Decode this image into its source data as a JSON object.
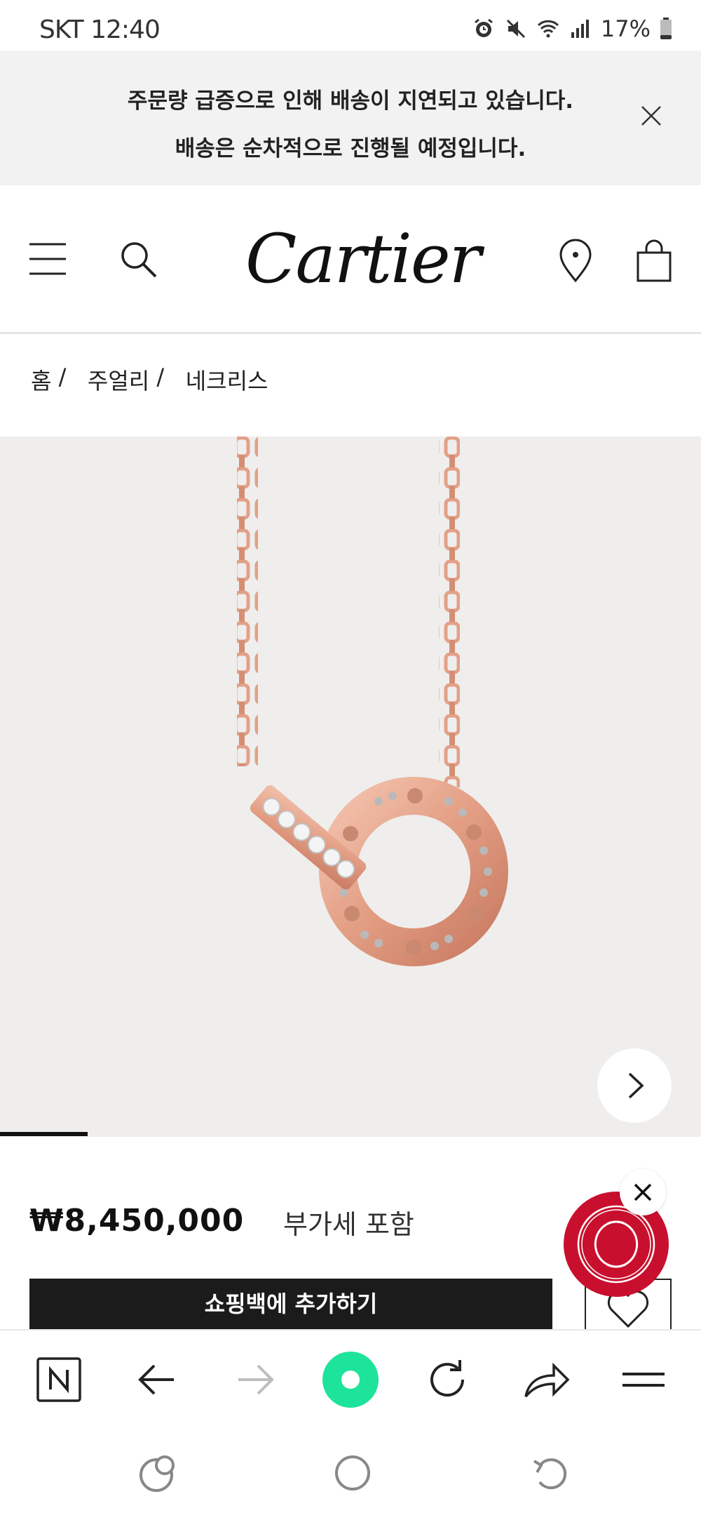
{
  "status_bar": {
    "carrier_time": "SKT 12:40",
    "battery": "17%",
    "icons": [
      "alarm-icon",
      "mute-icon",
      "wifi-icon",
      "signal-icon",
      "battery-icon"
    ]
  },
  "notice": {
    "line1": "주문량 급증으로 인해 배송이 지연되고 있습니다.",
    "line2": "배송은 순차적으로 진행될 예정입니다."
  },
  "header": {
    "logo": "Cartier",
    "icons": [
      "menu-icon",
      "search-icon",
      "location-icon",
      "shopping-bag-icon"
    ]
  },
  "breadcrumb": {
    "items": [
      "홈",
      "주얼리",
      "네크리스"
    ],
    "separator": "/"
  },
  "product": {
    "image_alt": "necklace-image",
    "price": "₩8,450,000",
    "vat_label": "부가세 포함",
    "add_to_bag_label": "쇼핑백에 추가하기",
    "carousel_progress": 0.125
  },
  "browser_toolbar": {
    "icons": [
      "naver-icon",
      "back-icon",
      "forward-icon",
      "home-record-icon",
      "reload-icon",
      "share-icon",
      "menu-icon"
    ]
  },
  "system_nav": {
    "icons": [
      "recent-apps-icon",
      "home-icon",
      "back-gesture-icon"
    ]
  },
  "colors": {
    "brand_red": "#c8102e",
    "banner_bg": "#f2f2f2",
    "button_dark": "#1b1b1b",
    "image_bg": "#efeeec",
    "rose_gold": "#e7a58c",
    "toolbar_green": "#1ee39a"
  }
}
